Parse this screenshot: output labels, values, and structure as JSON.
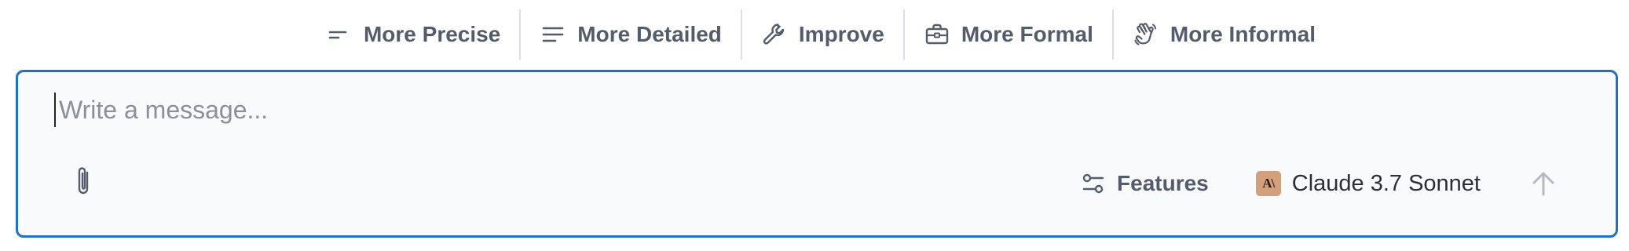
{
  "toolbar": {
    "items": [
      {
        "label": "More Precise",
        "icon": "short-lines-icon"
      },
      {
        "label": "More Detailed",
        "icon": "lines-icon"
      },
      {
        "label": "Improve",
        "icon": "wrench-icon"
      },
      {
        "label": "More Formal",
        "icon": "briefcase-icon"
      },
      {
        "label": "More Informal",
        "icon": "waving-hand-icon"
      }
    ]
  },
  "composer": {
    "placeholder": "Write a message...",
    "value": "",
    "attach_icon": "paperclip-icon",
    "features_label": "Features",
    "features_icon": "sliders-icon",
    "model_label": "Claude 3.7 Sonnet",
    "model_logo_text": "A\\",
    "send_icon": "arrow-up-icon"
  },
  "colors": {
    "accent": "#1f6fd0",
    "toolbar_text": "#545c6b",
    "composer_bg": "#f9fafc",
    "model_logo_bg": "#d4a07c",
    "send_disabled": "#b5bac2"
  }
}
